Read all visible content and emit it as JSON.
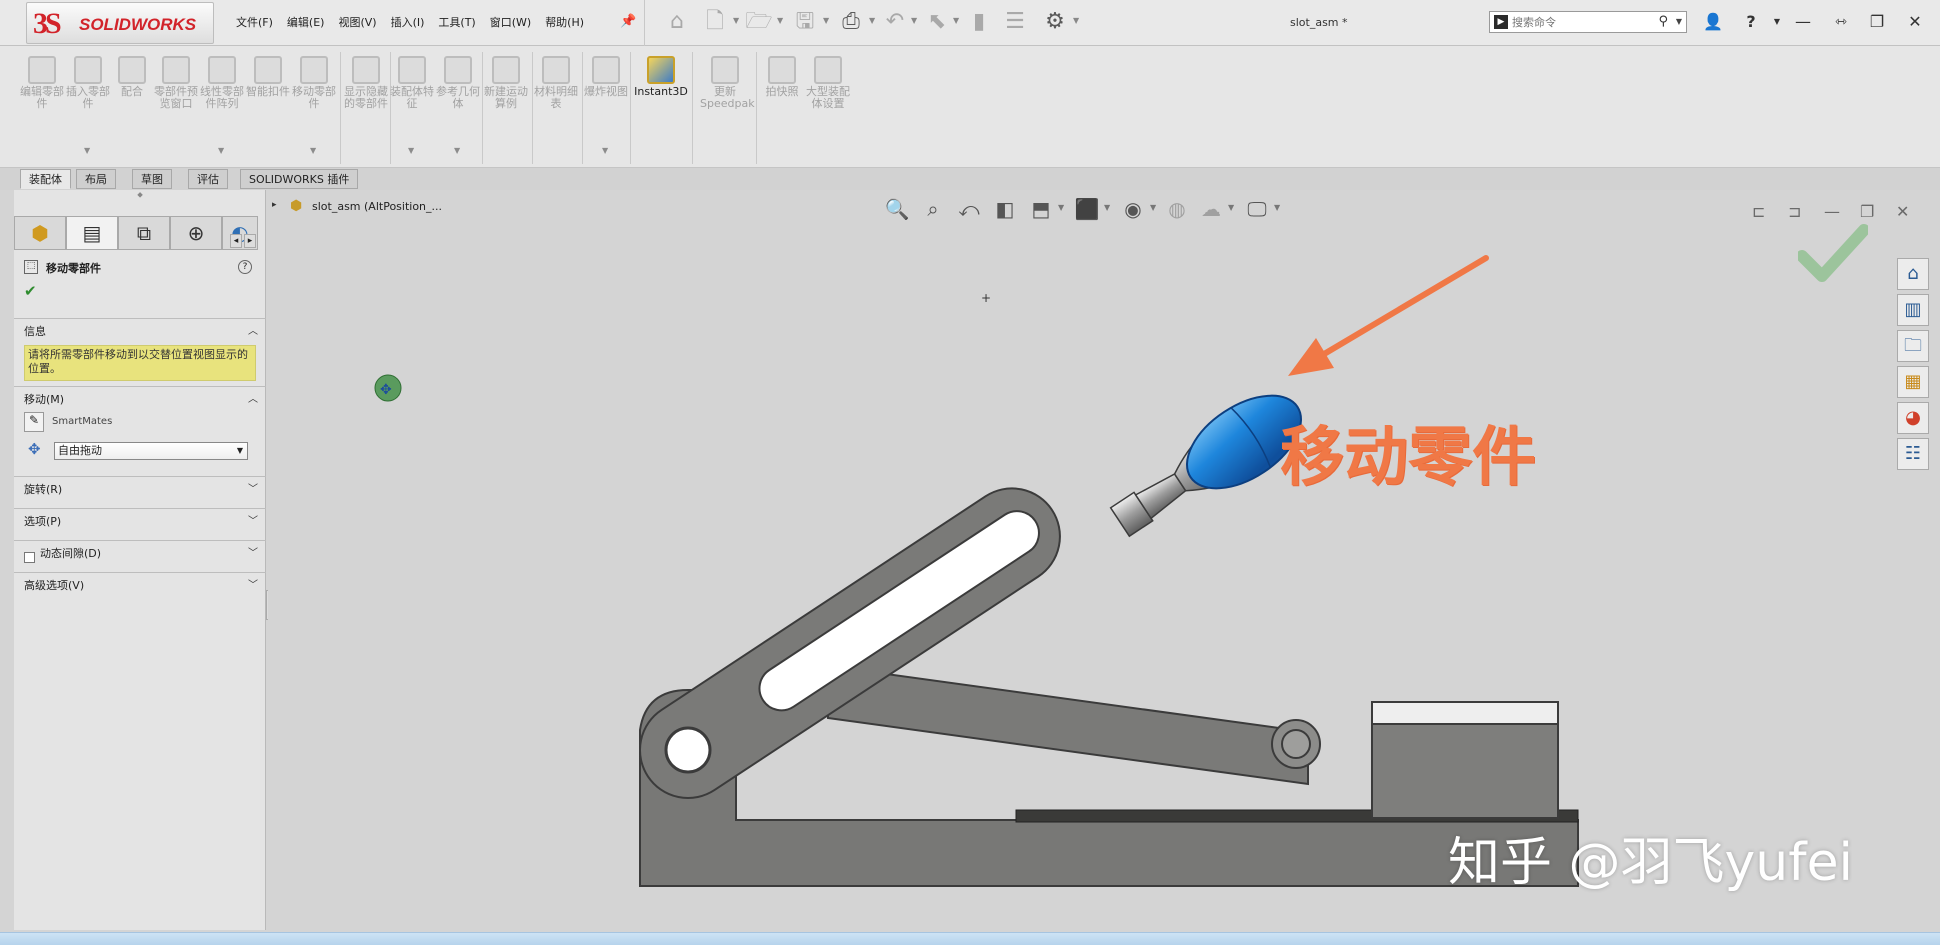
{
  "app": {
    "logo_mark": "3S",
    "logo_text": "SOLIDWORKS",
    "document_title": "slot_asm *"
  },
  "menu": [
    "文件(F)",
    "编辑(E)",
    "视图(V)",
    "插入(I)",
    "工具(T)",
    "窗口(W)",
    "帮助(H)"
  ],
  "search": {
    "placeholder": "搜索命令",
    "cmd_glyph": "▶"
  },
  "window_controls": {
    "help": "?",
    "minimize": "—",
    "restore": "❐",
    "close": "✕"
  },
  "toolbar_groups": {
    "edit_component": "编辑零部件",
    "insert_component": "插入零部件",
    "mate": "配合",
    "component_preview": "零部件预览窗口",
    "linear_pattern": "线性零部件阵列",
    "smart_fasteners": "智能扣件",
    "move_component": "移动零部件",
    "show_hidden": "显示隐藏的零部件",
    "assembly_features": "装配体特征",
    "reference_geometry": "参考几何体",
    "new_motion_study": "新建运动算例",
    "bill_of_materials": "材料明细表",
    "exploded_view": "爆炸视图",
    "instant3d": "Instant3D",
    "update_speedpak": "更新Speedpak",
    "snapshot": "拍快照",
    "large_assembly": "大型装配体设置"
  },
  "tabs": [
    "装配体",
    "布局",
    "草图",
    "评估",
    "SOLIDWORKS 插件"
  ],
  "property_manager": {
    "title": "移动零部件",
    "help": "?",
    "ok": "✔",
    "sections": {
      "info": "信息",
      "move": "移动(M)",
      "rotate": "旋转(R)",
      "options": "选项(P)",
      "dynamic_clearance": "动态间隙(D)",
      "advanced": "高级选项(V)"
    },
    "info_message": "请将所需零部件移动到以交替位置视图显示的位置。",
    "smartmates_label": "SmartMates",
    "move_mode_value": "自由拖动"
  },
  "feature_tree": {
    "root_label": "slot_asm  (AltPosition_..."
  },
  "annotation": {
    "text": "移动零件",
    "color": "#f07846"
  },
  "watermark": "知乎 @羽飞yufei",
  "colors": {
    "handle_knob": "#1e86dc",
    "body_gray": "#7b7b79",
    "accent_red": "#d2232a"
  }
}
